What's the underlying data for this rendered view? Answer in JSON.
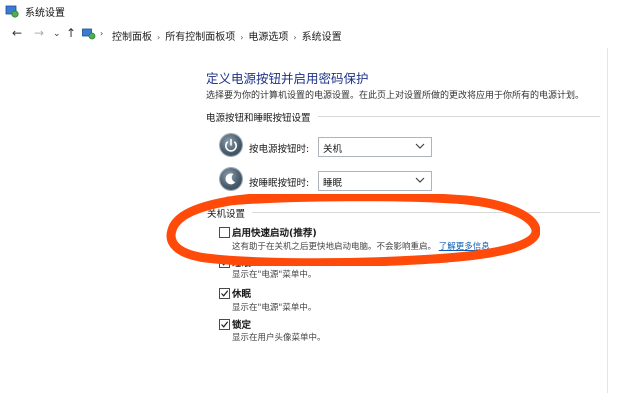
{
  "window": {
    "title": "系统设置"
  },
  "nav": {
    "back": "←",
    "forward": "→",
    "recent": "⌄",
    "up": "↑"
  },
  "breadcrumb": [
    "控制面板",
    "所有控制面板项",
    "电源选项",
    "系统设置"
  ],
  "page": {
    "heading": "定义电源按钮并启用密码保护",
    "subtext": "选择要为你的计算机设置的电源设置。在此页上对设置所做的更改将应用于你所有的电源计划。"
  },
  "power_buttons": {
    "section_title": "电源按钮和睡眠按钮设置",
    "power_label": "按电源按钮时:",
    "power_value": "关机",
    "sleep_label": "按睡眠按钮时:",
    "sleep_value": "睡眠"
  },
  "shutdown": {
    "section_title": "关机设置",
    "options": [
      {
        "label": "启用快速启动(推荐)",
        "checked": false,
        "desc": "这有助于在关机之后更快地启动电脑。不会影响重启。",
        "link": "了解更多信息"
      },
      {
        "label": "睡眠",
        "checked": true,
        "desc": "显示在\"电源\"菜单中。"
      },
      {
        "label": "休眠",
        "checked": true,
        "desc": "显示在\"电源\"菜单中。"
      },
      {
        "label": "锁定",
        "checked": true,
        "desc": "显示在用户头像菜单中。"
      }
    ]
  },
  "colors": {
    "heading": "#1e3287",
    "link": "#0a5fb4",
    "annotation": "#ff4a0a"
  }
}
